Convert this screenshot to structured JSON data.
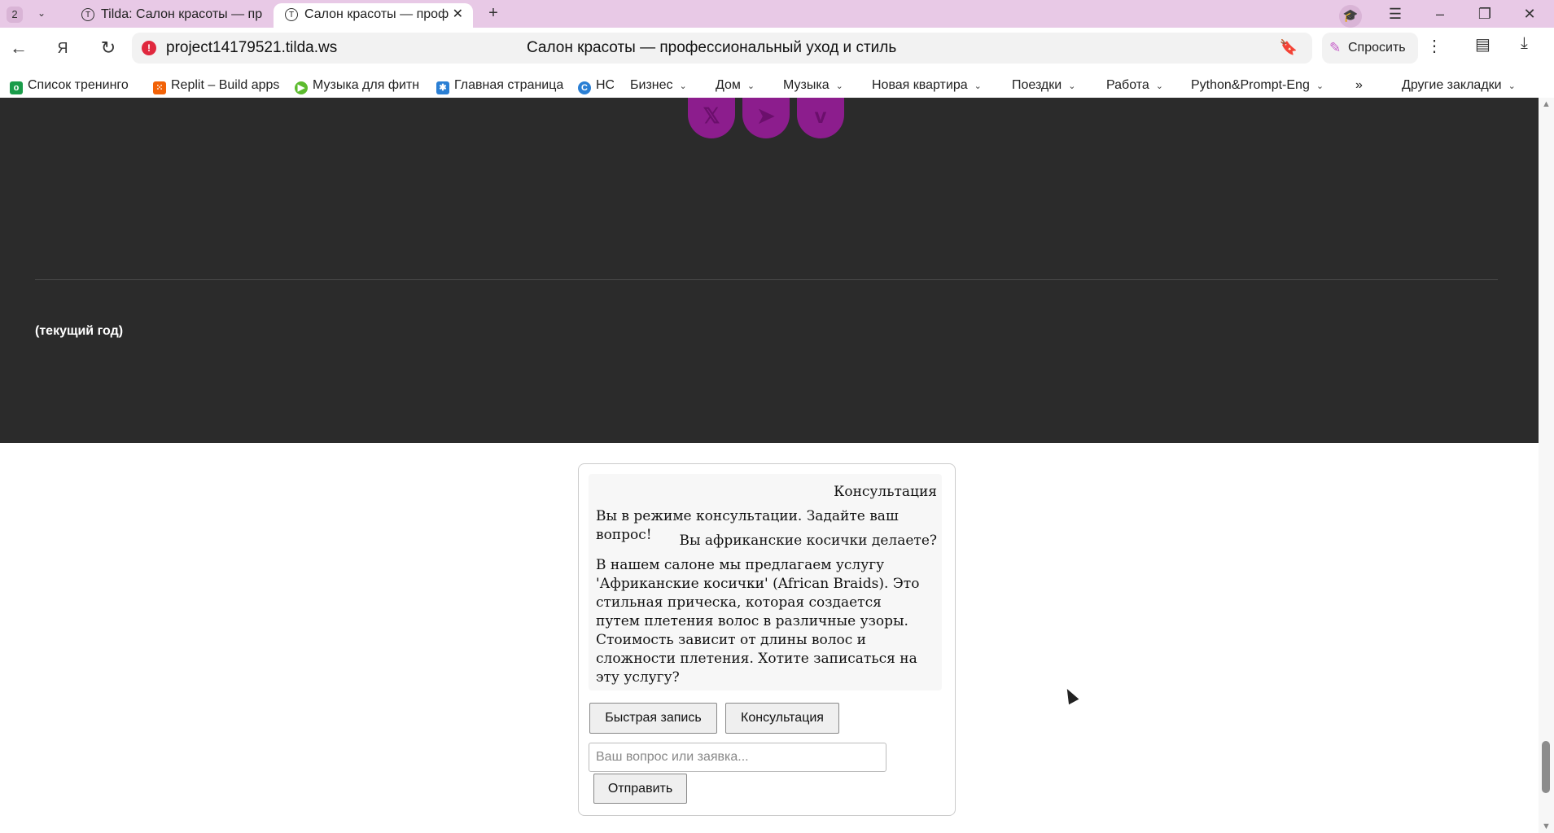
{
  "browser": {
    "tab_count": "2",
    "tabs": [
      {
        "title": "Tilda: Салон красоты — пр"
      },
      {
        "title": "Салон красоты — проф"
      }
    ],
    "new_tab_icon": "plus-icon",
    "window_controls": [
      "menu-icon",
      "minimize-icon",
      "restore-icon",
      "close-icon"
    ]
  },
  "address_bar": {
    "url": "project14179521.tilda.ws",
    "page_title": "Салон красоты — профессиональный уход и стиль",
    "ask_label": "Спросить"
  },
  "bookmarks": {
    "items": [
      {
        "label": "Список тренинго",
        "icon_color": "#1a9c4a"
      },
      {
        "label": "Replit – Build apps",
        "icon_color": "#f26207"
      },
      {
        "label": "Музыка для фитн",
        "icon_color": "#5cbb2e"
      },
      {
        "label": "Главная страница",
        "icon_color": "#2a7fd4"
      },
      {
        "label": "НС",
        "icon_color": "#2a7fd4"
      },
      {
        "label": "Бизнес"
      },
      {
        "label": "Дом"
      },
      {
        "label": "Музыка"
      },
      {
        "label": "Новая квартира"
      },
      {
        "label": "Поездки"
      },
      {
        "label": "Работа"
      },
      {
        "label": "Python&Prompt-Eng"
      },
      {
        "label": "»"
      },
      {
        "label": "Другие закладки"
      }
    ]
  },
  "footer": {
    "social_icons": [
      "x-icon",
      "telegram-icon",
      "vimeo-icon"
    ],
    "year_text": "(текущий год)",
    "accent_color": "#8c1d8d"
  },
  "chat": {
    "messages": [
      {
        "side": "right",
        "text": "Консультация"
      },
      {
        "side": "left",
        "text": "Вы в режиме консультации. Задайте ваш вопрос!"
      },
      {
        "side": "right",
        "text": "Вы африканские косички делаете?"
      },
      {
        "side": "left",
        "text": "В нашем салоне мы предлагаем услугу 'Африканские косички' (African Braids). Это стильная прическа, которая создается путем плетения волос в различные узоры. Стоимость зависит от длины волос и сложности плетения. Хотите записаться на эту услугу?"
      }
    ],
    "quick_book_label": "Быстрая запись",
    "consult_label": "Консультация",
    "input_placeholder": "Ваш вопрос или заявка...",
    "send_label": "Отправить"
  }
}
